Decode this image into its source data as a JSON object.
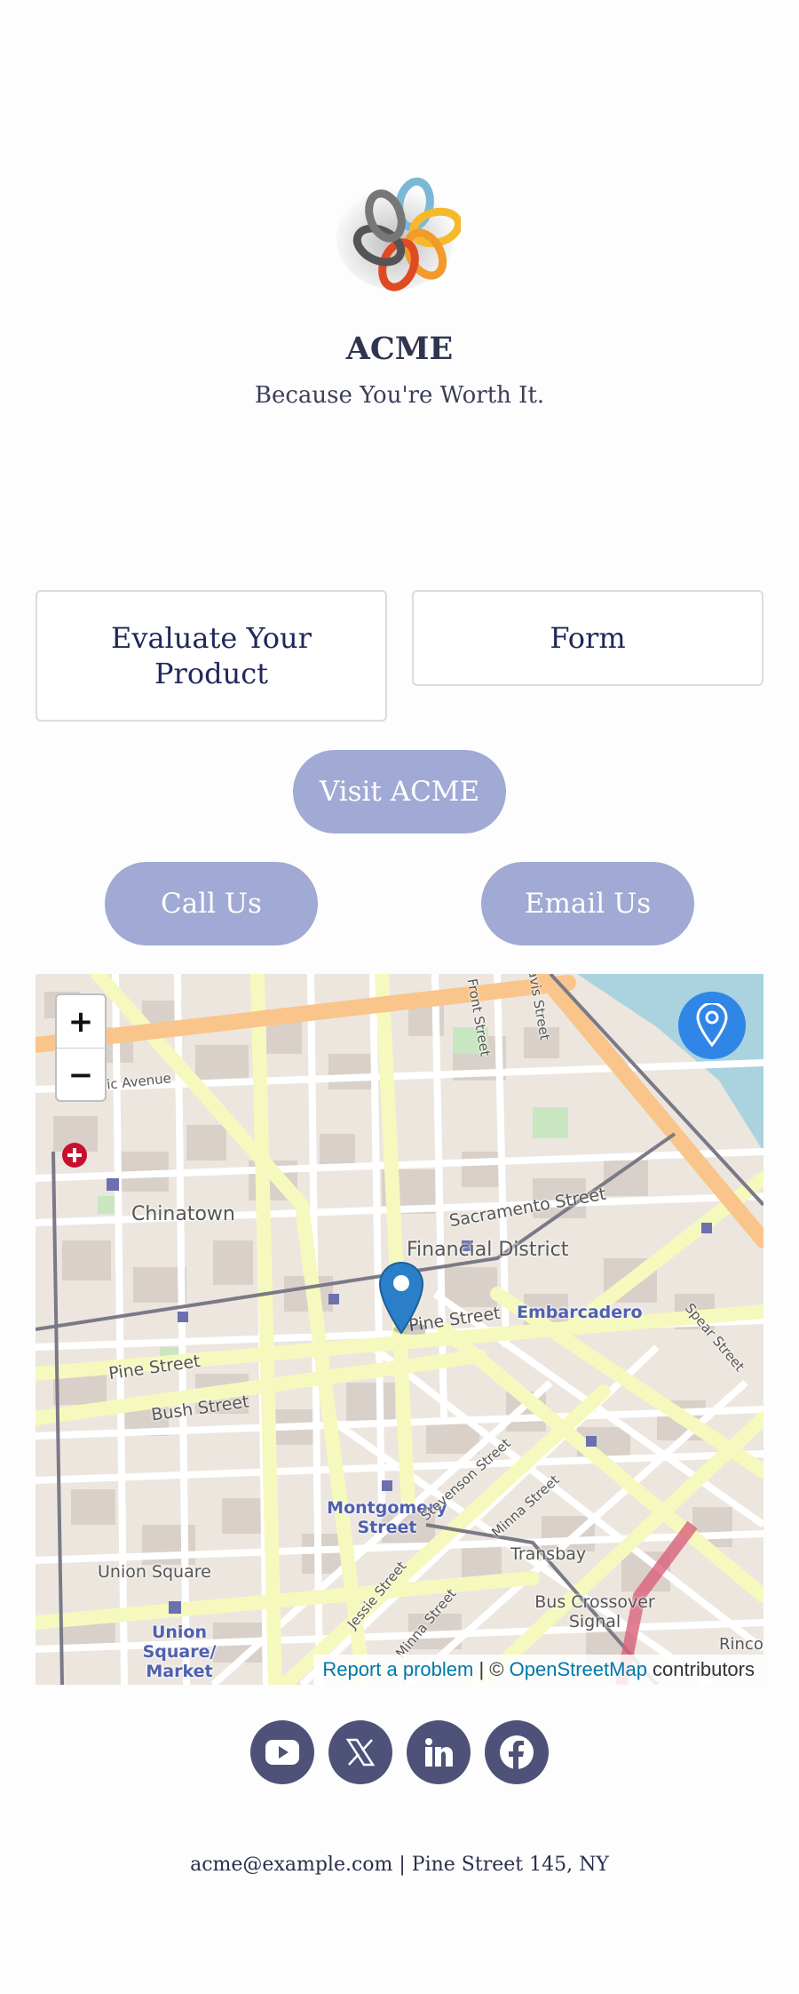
{
  "brand": {
    "name": "ACME",
    "tagline": "Because You're Worth It."
  },
  "cards": {
    "evaluate_label": "Evaluate Your Product",
    "form_label": "Form"
  },
  "buttons": {
    "visit_label": "Visit ACME",
    "call_label": "Call Us",
    "email_label": "Email Us"
  },
  "map": {
    "zoom_in": "+",
    "zoom_out": "−",
    "labels": {
      "chinatown": "Chinatown",
      "financial_district": "Financial District",
      "sacramento_street": "Sacramento Street",
      "pine_street_1": "Pine Street",
      "pine_street_2": "Pine Street",
      "bush_street": "Bush Street",
      "embarcadero": "Embarcadero",
      "montgomery_street": "Montgomery Street",
      "union_square": "Union Square",
      "union_square_market": "Union Square/ Market",
      "transbay": "Transbay",
      "bus_crossover_signal": "Bus Crossover Signal",
      "front_street": "Front Street",
      "davis_street": "Davis Street",
      "spear_street": "Spear Street",
      "stevenson_street": "Stevenson Street",
      "minna_street_1": "Minna Street",
      "jessie_street": "Jessie Street",
      "minna_street_2": "Minna Street",
      "ave_fragment": "ic Avenue",
      "rinco": "Rinco"
    },
    "attribution": {
      "report": "Report a problem",
      "sep": " | © ",
      "osm": "OpenStreetMap",
      "contributors": " contributors"
    }
  },
  "socials": [
    "youtube-icon",
    "x-icon",
    "linkedin-icon",
    "facebook-icon"
  ],
  "footer": {
    "text": "acme@example.com | Pine Street 145, NY"
  },
  "colors": {
    "pill": "#a0aad4",
    "social": "#4e5278",
    "locate": "#2f86e6",
    "text": "#2b2f4a"
  }
}
